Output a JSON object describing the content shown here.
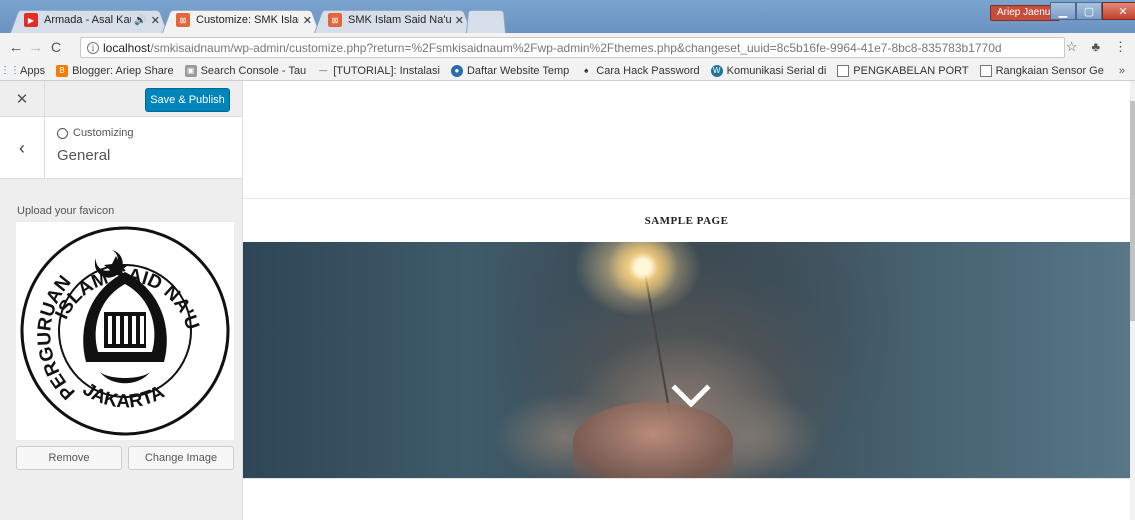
{
  "browser": {
    "tabs": [
      {
        "title": "Armada - Asal Kau Ba",
        "favicon": "youtube-icon",
        "audio": true,
        "active": false
      },
      {
        "title": "Customize: SMK Islam Sa",
        "favicon": "wordpress-site-icon",
        "active": true
      },
      {
        "title": "SMK Islam Said Na'um –",
        "favicon": "wordpress-site-icon",
        "active": false
      }
    ],
    "user_name": "Ariep Jaenul",
    "address": {
      "host": "localhost",
      "path": "/smkisaidnaum/wp-admin/customize.php?return=%2Fsmkisaidnaum%2Fwp-admin%2Fthemes.php&changeset_uuid=8c5b16fe-9964-41e7-8bc8-835783b1770d"
    },
    "bookmarks": [
      {
        "label": "Apps",
        "icon": "apps-grid-icon"
      },
      {
        "label": "Blogger: Ariep Share",
        "icon": "blogger-icon"
      },
      {
        "label": "Search Console - Tau",
        "icon": "search-console-icon"
      },
      {
        "label": "[TUTORIAL]: Instalasi",
        "icon": "dash-icon"
      },
      {
        "label": "Daftar Website Temp",
        "icon": "site-icon"
      },
      {
        "label": "Cara Hack Password",
        "icon": "hack-icon"
      },
      {
        "label": "Komunikasi Serial di",
        "icon": "wordpress-icon"
      },
      {
        "label": "PENGKABELAN PORT",
        "icon": "document-icon"
      },
      {
        "label": "Rangkaian Sensor Ge",
        "icon": "document-icon"
      }
    ],
    "bookmarks_more": "»"
  },
  "customizer": {
    "publish_label": "Save & Publish",
    "breadcrumb": "Customizing",
    "section_title": "General",
    "favicon_label": "Upload your favicon",
    "favicon_logo": {
      "top_text": "ISLAM SAID NA'UM",
      "left_text": "PERGURUAN",
      "bottom_text": "JAKARTA"
    },
    "remove_label": "Remove",
    "change_label": "Change Image"
  },
  "preview": {
    "nav_item": "SAMPLE PAGE"
  },
  "colors": {
    "publish_button": "#0085ba",
    "titlebar": "#6b93c2"
  }
}
